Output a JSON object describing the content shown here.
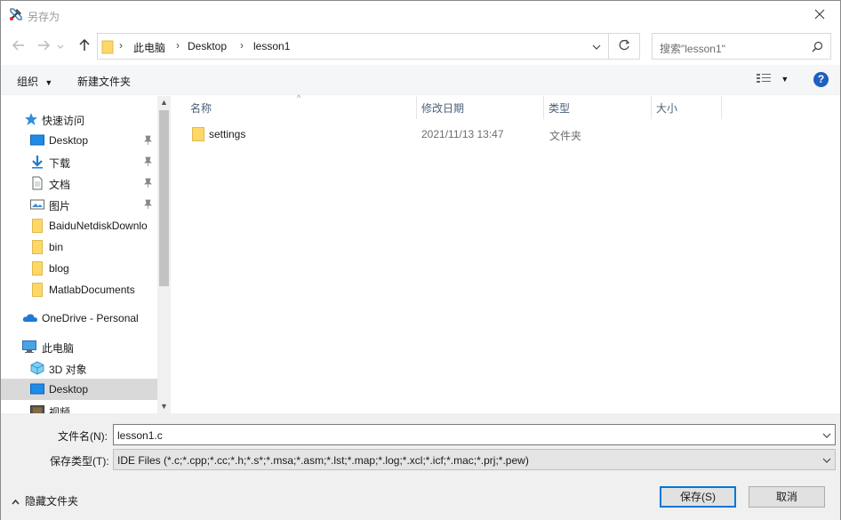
{
  "window": {
    "title": "另存为"
  },
  "nav": {
    "back": "back",
    "forward": "forward",
    "up": "up"
  },
  "address": {
    "crumbs": [
      "此电脑",
      "Desktop",
      "lesson1"
    ],
    "search_placeholder": "搜索\"lesson1\""
  },
  "toolbar": {
    "organize": "组织",
    "new_folder": "新建文件夹"
  },
  "sidebar": {
    "items": [
      {
        "label": "快速访问",
        "icon": "star-icon"
      },
      {
        "label": "Desktop",
        "icon": "desktop-icon",
        "pinned": true
      },
      {
        "label": "下载",
        "icon": "download-icon",
        "pinned": true
      },
      {
        "label": "文档",
        "icon": "document-icon",
        "pinned": true
      },
      {
        "label": "图片",
        "icon": "picture-icon",
        "pinned": true
      },
      {
        "label": "BaiduNetdiskDownlo",
        "icon": "folder-icon"
      },
      {
        "label": "bin",
        "icon": "folder-icon"
      },
      {
        "label": "blog",
        "icon": "folder-icon"
      },
      {
        "label": "MatlabDocuments",
        "icon": "folder-icon"
      },
      {
        "label": "OneDrive - Personal",
        "icon": "cloud-icon"
      },
      {
        "label": "此电脑",
        "icon": "computer-icon"
      },
      {
        "label": "3D 对象",
        "icon": "cube-icon"
      },
      {
        "label": "Desktop",
        "icon": "desktop-icon",
        "selected": true
      },
      {
        "label": "视频",
        "icon": "video-icon"
      }
    ]
  },
  "columns": {
    "name": "名称",
    "modified": "修改日期",
    "type": "类型",
    "size": "大小"
  },
  "files": [
    {
      "name": "settings",
      "modified": "2021/11/13 13:47",
      "type": "文件夹",
      "size": ""
    }
  ],
  "form": {
    "filename_label": "文件名(N):",
    "filename_value": "lesson1.c",
    "savetype_label": "保存类型(T):",
    "savetype_value": "IDE Files (*.c;*.cpp;*.cc;*.h;*.s*;*.msa;*.asm;*.lst;*.map;*.log;*.xcl;*.icf;*.mac;*.prj;*.pew)"
  },
  "footer": {
    "hide_folders": "隐藏文件夹",
    "save": "保存(S)",
    "cancel": "取消"
  },
  "colors": {
    "accent": "#0078d7",
    "folder": "#ffd766",
    "selection": "#d9d9d9",
    "help": "#1e5fbf"
  }
}
